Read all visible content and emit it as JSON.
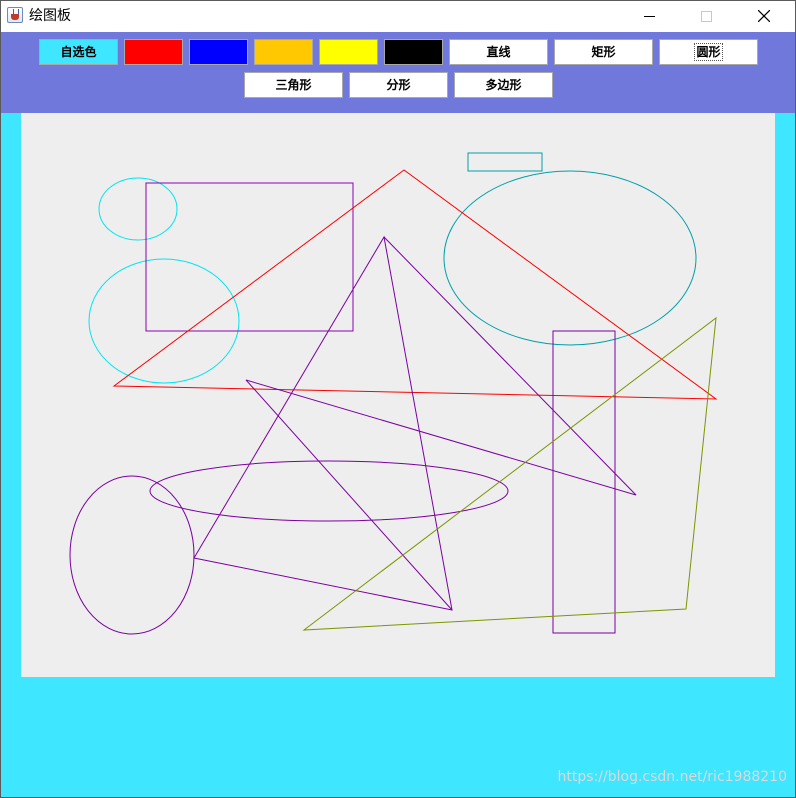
{
  "window": {
    "title": "绘图板",
    "icon": "java-cup-icon",
    "controls": {
      "minimize": "minimize-icon",
      "maximize": "maximize-icon",
      "close": "close-icon"
    }
  },
  "toolbar": {
    "custom_color_label": "自选色",
    "custom_color_bg": "#3fe6ff",
    "swatches": [
      {
        "name": "red",
        "color": "#ff0000"
      },
      {
        "name": "blue",
        "color": "#0000ff"
      },
      {
        "name": "orange",
        "color": "#ffc800"
      },
      {
        "name": "yellow",
        "color": "#ffff00"
      },
      {
        "name": "black",
        "color": "#000000"
      }
    ],
    "shapes": [
      "直线",
      "矩形",
      "圆形",
      "三角形",
      "分形",
      "多边形"
    ],
    "focused_shape": "圆形"
  },
  "colors": {
    "toolbar_bg": "#7079db",
    "window_bg": "#3fe6ff",
    "canvas_bg": "#eeeeee"
  },
  "footer": {
    "watermark": "https://blog.csdn.net/ric1988210"
  }
}
